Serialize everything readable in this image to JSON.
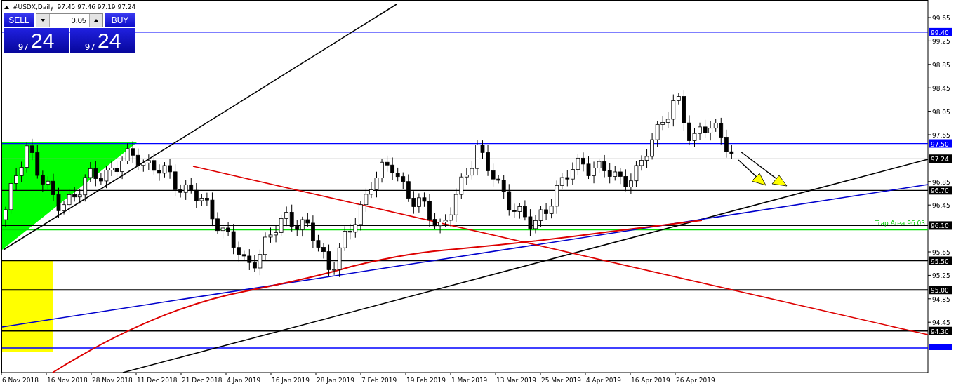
{
  "header": {
    "symbol": "#USDX,Daily",
    "ohlc": "97.45 97.46 97.19 97.24"
  },
  "trade_panel": {
    "sell": {
      "label": "SELL",
      "price_prefix": "97",
      "price_main": "24"
    },
    "lot": "0.05",
    "buy": {
      "label": "BUY",
      "price_prefix": "97",
      "price_main": "24"
    }
  },
  "chart": {
    "price_ticks": [
      "99.65",
      "99.25",
      "98.85",
      "98.45",
      "98.05",
      "97.65",
      "96.85",
      "96.45",
      "95.65",
      "95.25",
      "94.85",
      "94.45"
    ],
    "levels": [
      {
        "label": "99.40",
        "color": "#0000ff",
        "kind": "line"
      },
      {
        "label": "97.50",
        "color": "#0000ff",
        "kind": "line"
      },
      {
        "label": "97.24",
        "color": "#000000",
        "kind": "bid"
      },
      {
        "label": "96.70",
        "color": "#000000",
        "kind": "line"
      },
      {
        "label": "96.10",
        "color": "#000000",
        "kind": "line"
      },
      {
        "label": "95.50",
        "color": "#000000",
        "kind": "line"
      },
      {
        "label": "95.00",
        "color": "#000000",
        "kind": "thick"
      },
      {
        "label": "94.30",
        "color": "#000000",
        "kind": "line"
      }
    ],
    "trap": {
      "label": "Trap Area",
      "value": "96.03"
    },
    "dates": [
      "6 Nov 2018",
      "16 Nov 2018",
      "28 Nov 2018",
      "11 Dec 2018",
      "21 Dec 2018",
      "4 Jan 2019",
      "16 Jan 2019",
      "28 Jan 2019",
      "7 Feb 2019",
      "19 Feb 2019",
      "1 Mar 2019",
      "13 Mar 2019",
      "25 Mar 2019",
      "4 Apr 2019",
      "16 Apr 2019",
      "26 Apr 2019"
    ]
  }
}
